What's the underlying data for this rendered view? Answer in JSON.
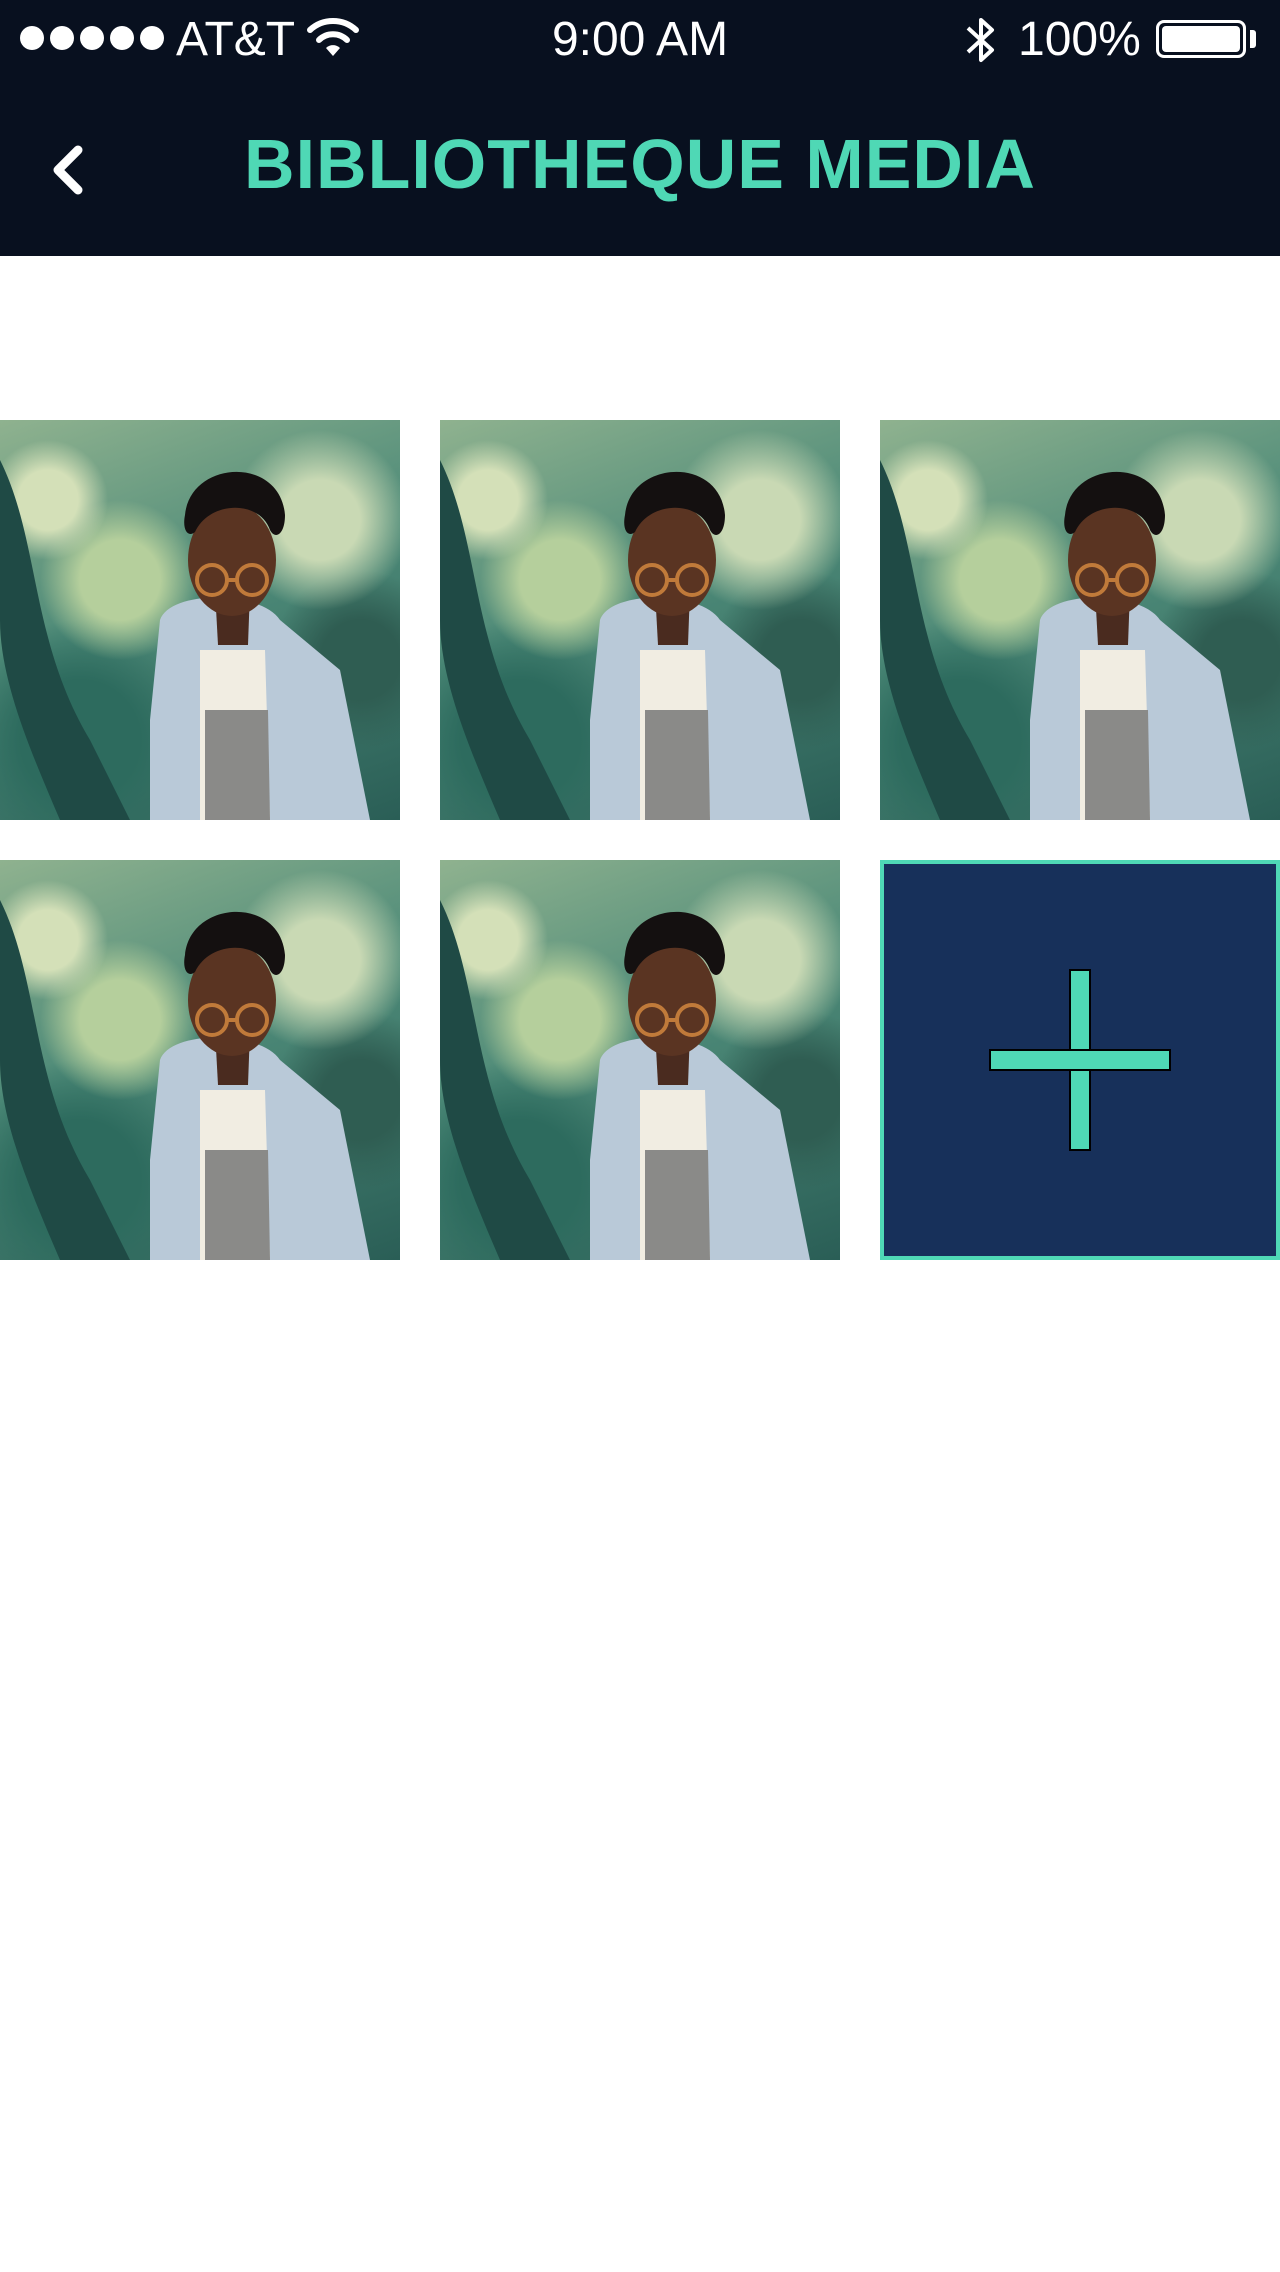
{
  "status_bar": {
    "carrier": "AT&T",
    "time": "9:00 AM",
    "battery_percent": "100%",
    "signal_bars": 5,
    "icons": [
      "signal-dots-icon",
      "wifi-icon",
      "bluetooth-icon",
      "battery-icon"
    ]
  },
  "nav": {
    "title": "BIBLIOTHEQUE MEDIA",
    "back_icon": "chevron-left-icon"
  },
  "media": {
    "items": [
      {
        "type": "photo"
      },
      {
        "type": "photo"
      },
      {
        "type": "photo"
      },
      {
        "type": "photo"
      },
      {
        "type": "photo"
      }
    ],
    "add_icon": "plus-icon"
  },
  "colors": {
    "header_bg": "#08101f",
    "accent": "#4fd8b5",
    "add_tile_bg": "#17305a",
    "page_bg": "#ffffff"
  }
}
